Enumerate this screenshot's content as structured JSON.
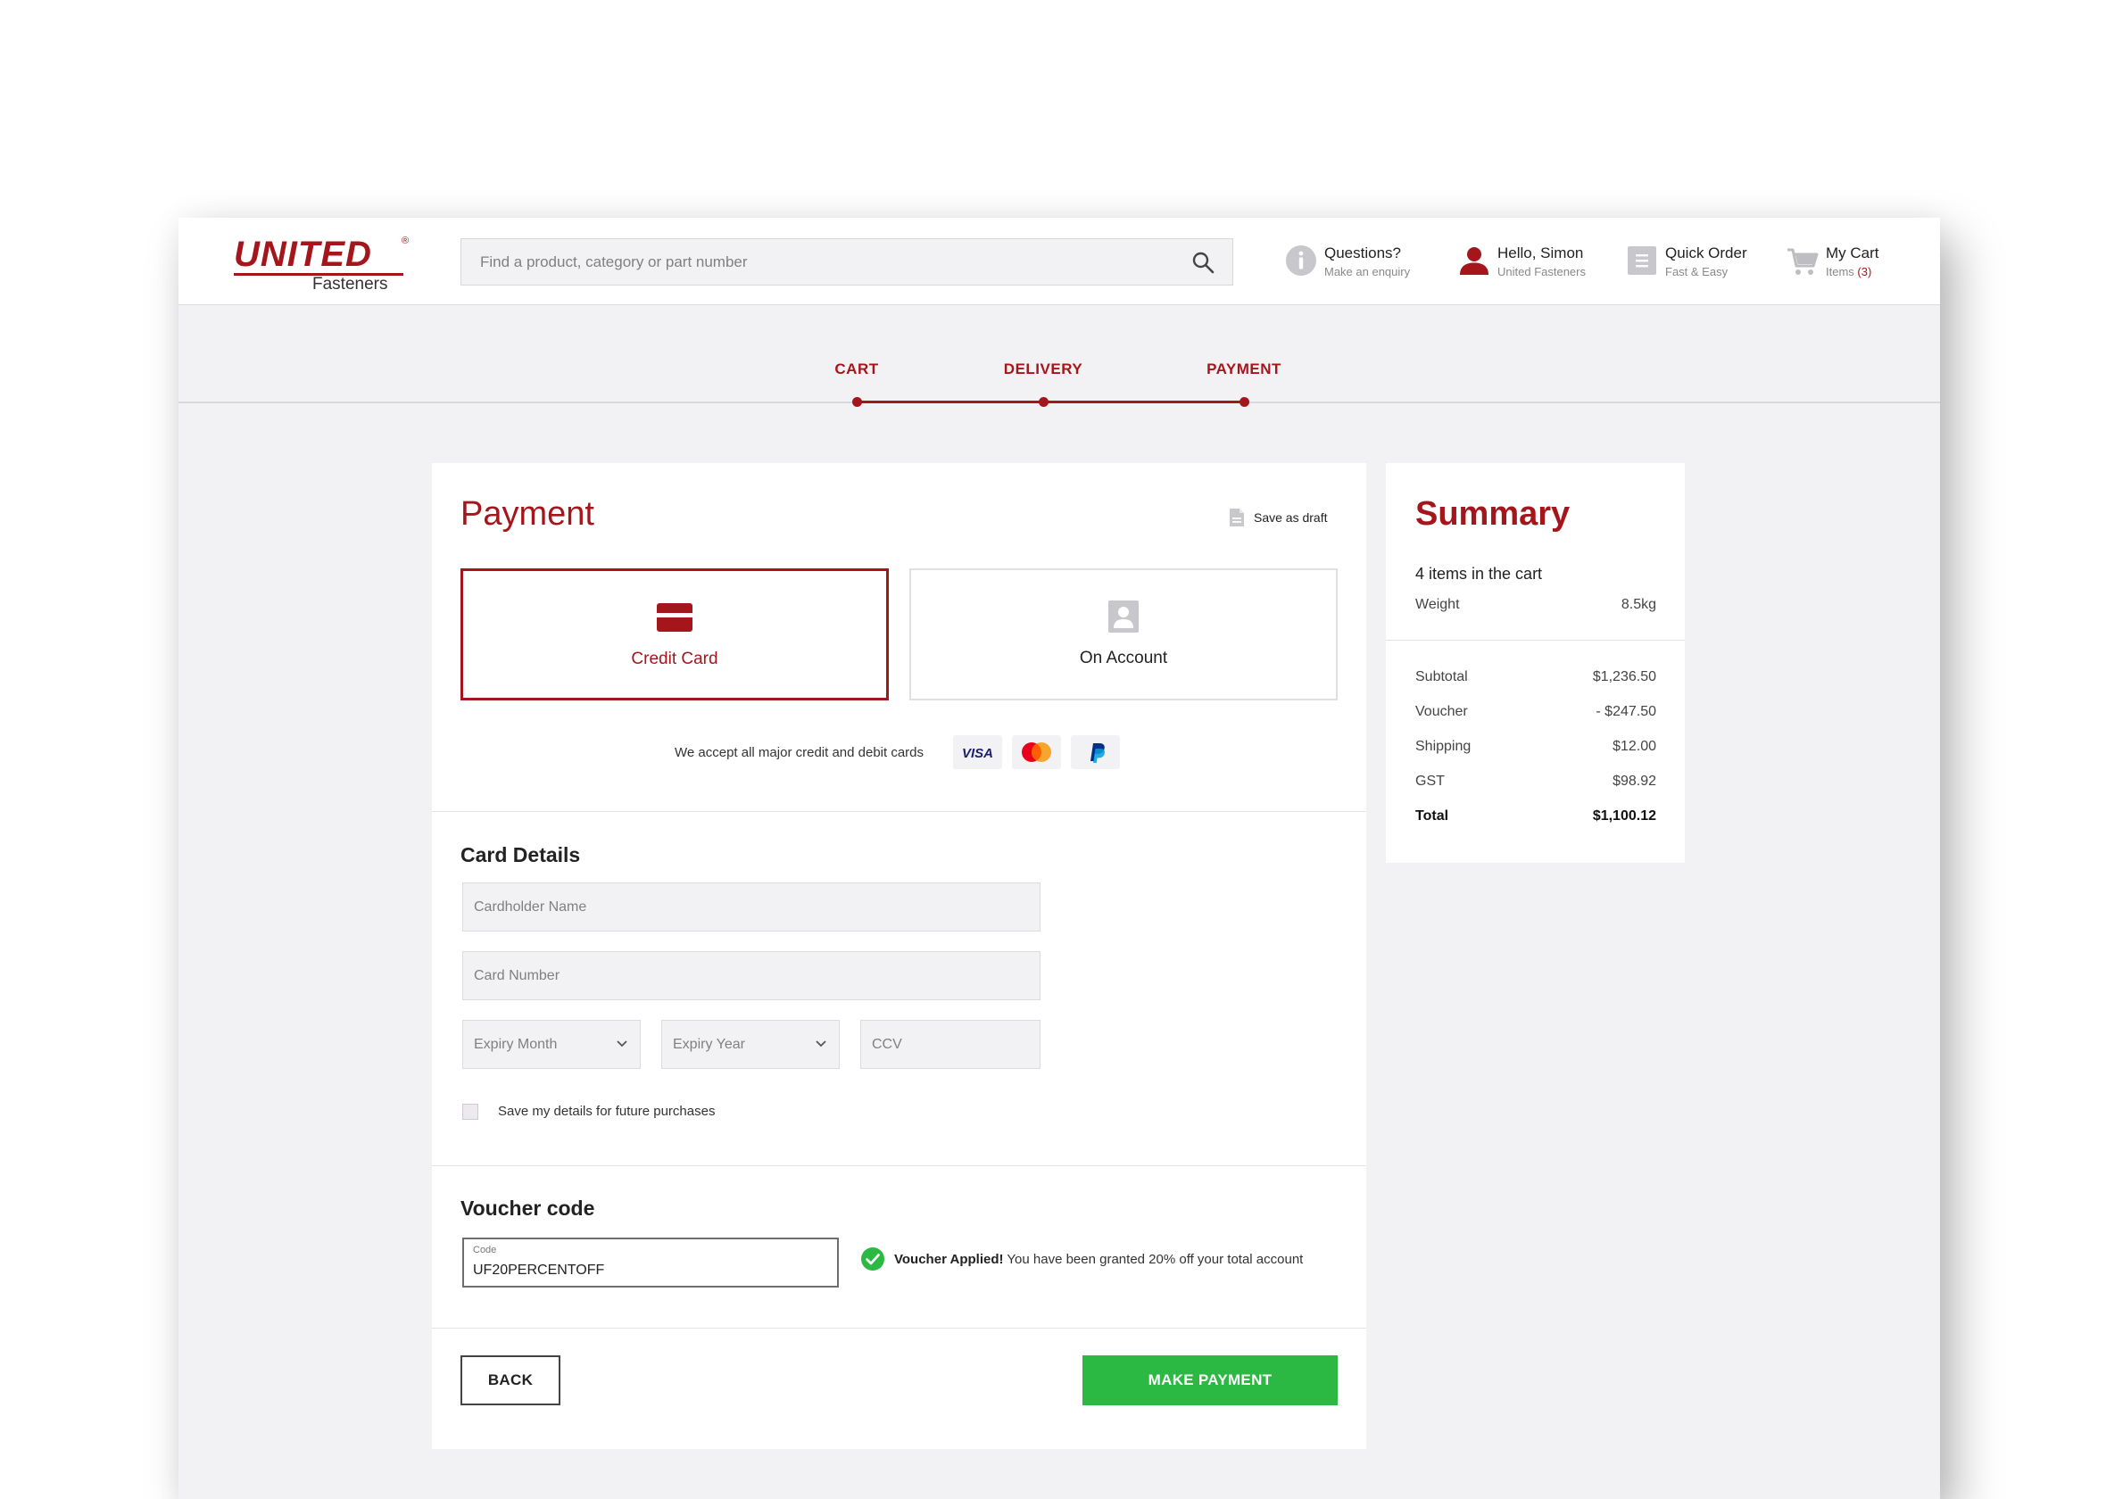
{
  "header": {
    "logo_text": "UNITED",
    "logo_sub": "Fasteners",
    "logo_reg": "®",
    "search_placeholder": "Find a product, category or part number",
    "questions": {
      "title": "Questions?",
      "subtitle": "Make an enquiry"
    },
    "user": {
      "title": "Hello, Simon",
      "subtitle": "United Fasteners"
    },
    "quick_order": {
      "title": "Quick Order",
      "subtitle": "Fast & Easy"
    },
    "cart": {
      "title": "My Cart",
      "subtitle_prefix": "Items",
      "count": "(3)"
    }
  },
  "steps": [
    "CART",
    "DELIVERY",
    "PAYMENT"
  ],
  "payment": {
    "title": "Payment",
    "save_draft": "Save as draft",
    "options": [
      {
        "label": "Credit Card",
        "selected": true,
        "icon": "credit-card-icon"
      },
      {
        "label": "On Account",
        "selected": false,
        "icon": "account-icon"
      }
    ],
    "accept_text": "We accept all major credit and debit cards",
    "card_brands": [
      "visa-logo",
      "mastercard-logo",
      "paypal-logo"
    ],
    "card_details": {
      "title": "Card Details",
      "cardholder_placeholder": "Cardholder Name",
      "card_number_placeholder": "Card Number",
      "expiry_month": "Expiry Month",
      "expiry_year": "Expiry Year",
      "ccv_placeholder": "CCV",
      "save_details": "Save my details for future purchases"
    },
    "voucher": {
      "title": "Voucher code",
      "field_label": "Code",
      "value": "UF20PERCENTOFF",
      "status_bold": "Voucher Applied!",
      "status_text": " You have been granted 20% off your total account"
    },
    "back_label": "BACK",
    "pay_label": "MAKE PAYMENT"
  },
  "summary": {
    "title": "Summary",
    "items_text": "4 items in the cart",
    "weight": {
      "label": "Weight",
      "value": "8.5kg"
    },
    "rows": [
      {
        "label": "Subtotal",
        "value": "$1,236.50"
      },
      {
        "label": "Voucher",
        "value": "- $247.50"
      },
      {
        "label": "Shipping",
        "value": "$12.00"
      },
      {
        "label": "GST",
        "value": "$98.92"
      }
    ],
    "total": {
      "label": "Total",
      "value": "$1,100.12"
    }
  },
  "colors": {
    "brand": "#a5161c",
    "success": "#2bb843",
    "panel_bg": "#f2f1f4"
  }
}
